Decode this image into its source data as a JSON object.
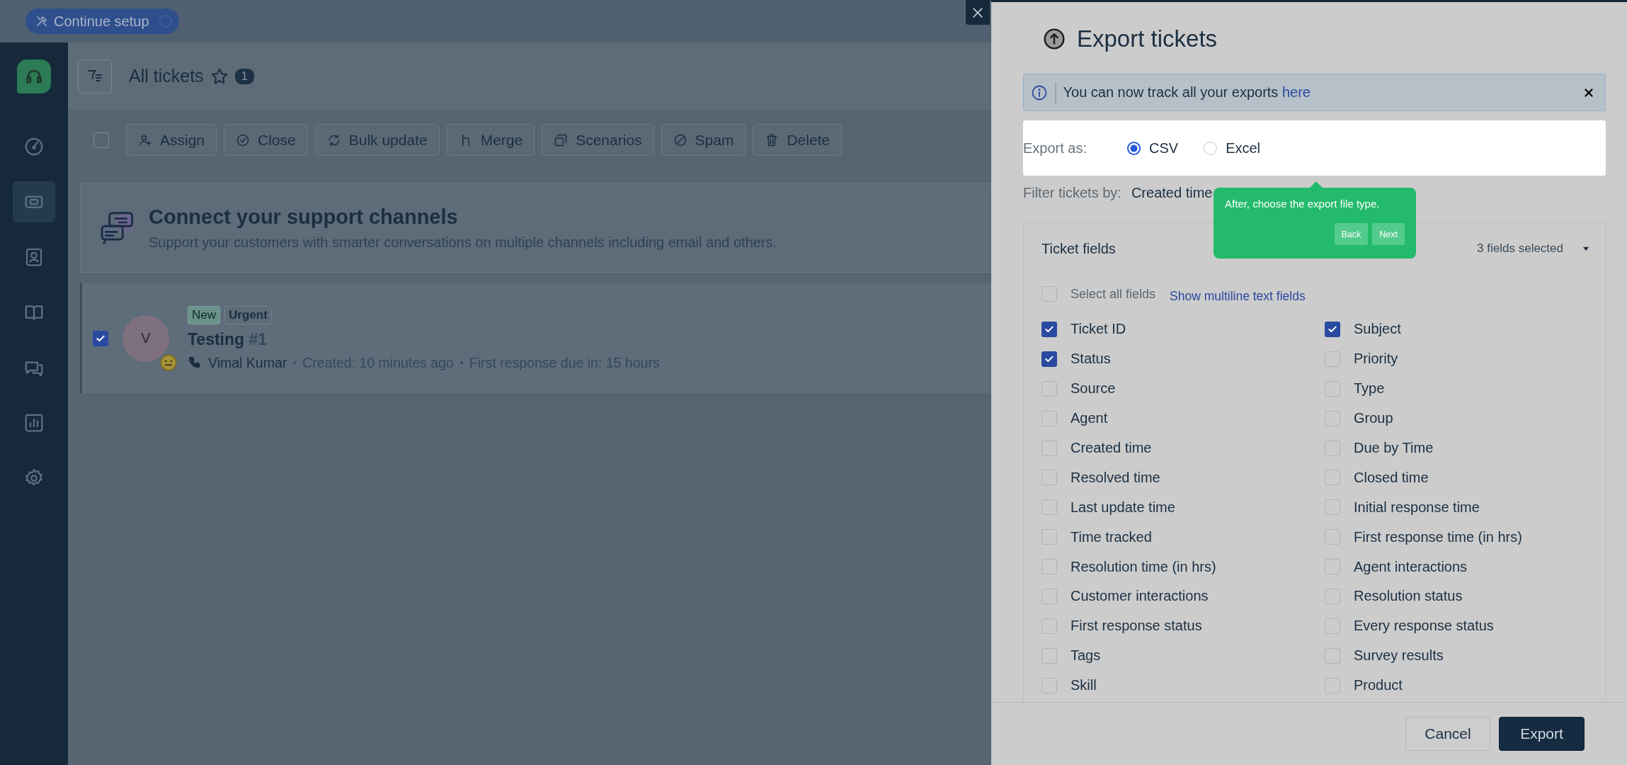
{
  "setup_button": {
    "label": "Continue setup"
  },
  "sidebar": {
    "items": [
      {
        "kind": "gauge",
        "selected": false
      },
      {
        "kind": "ticket",
        "selected": true
      },
      {
        "kind": "contact",
        "selected": false
      },
      {
        "kind": "book",
        "selected": false
      },
      {
        "kind": "chat",
        "selected": false
      },
      {
        "kind": "report",
        "selected": false
      },
      {
        "kind": "settings",
        "selected": false
      }
    ]
  },
  "header": {
    "title": "All tickets",
    "count": "1"
  },
  "toolbar": {
    "select_all": {
      "checked": false
    },
    "actions": [
      {
        "kind": "assign",
        "label": "Assign"
      },
      {
        "kind": "close",
        "label": "Close"
      },
      {
        "kind": "bulk",
        "label": "Bulk update"
      },
      {
        "kind": "merge",
        "label": "Merge"
      },
      {
        "kind": "scenarios",
        "label": "Scenarios"
      },
      {
        "kind": "spam",
        "label": "Spam"
      },
      {
        "kind": "delete",
        "label": "Delete"
      }
    ]
  },
  "banner": {
    "title": "Connect your support channels",
    "text": "Support your customers with smarter conversations on multiple channels including email and others."
  },
  "tickets": [
    {
      "checked": true,
      "avatar": "V",
      "tags": [
        {
          "kind": "status",
          "label": "New"
        },
        {
          "kind": "priority",
          "label": "Urgent"
        }
      ],
      "subject": "Testing",
      "number": "#1",
      "requester": "Vimal Kumar",
      "created": "Created: 10 minutes ago",
      "due": "First response due in: 15 hours"
    }
  ],
  "export_panel": {
    "title": "Export tickets",
    "info": {
      "text": "You can now track all your exports",
      "link": "here"
    },
    "export_as": {
      "label": "Export as:",
      "options": [
        {
          "label": "CSV",
          "selected": true
        },
        {
          "label": "Excel",
          "selected": false
        }
      ]
    },
    "filter": {
      "label": "Filter tickets by:",
      "value": "Created time"
    },
    "fields_card": {
      "title": "Ticket fields",
      "summary": "3 fields selected",
      "expanded": true,
      "select_all": {
        "label": "Select all fields",
        "checked": false
      },
      "multiline_link": "Show multiline text fields",
      "fields": [
        {
          "label": "Ticket ID",
          "checked": true
        },
        {
          "label": "Subject",
          "checked": true
        },
        {
          "label": "Status",
          "checked": true
        },
        {
          "label": "Priority",
          "checked": false
        },
        {
          "label": "Source",
          "checked": false
        },
        {
          "label": "Type",
          "checked": false
        },
        {
          "label": "Agent",
          "checked": false
        },
        {
          "label": "Group",
          "checked": false
        },
        {
          "label": "Created time",
          "checked": false
        },
        {
          "label": "Due by Time",
          "checked": false
        },
        {
          "label": "Resolved time",
          "checked": false
        },
        {
          "label": "Closed time",
          "checked": false
        },
        {
          "label": "Last update time",
          "checked": false
        },
        {
          "label": "Initial response time",
          "checked": false
        },
        {
          "label": "Time tracked",
          "checked": false
        },
        {
          "label": "First response time (in hrs)",
          "checked": false
        },
        {
          "label": "Resolution time (in hrs)",
          "checked": false
        },
        {
          "label": "Agent interactions",
          "checked": false
        },
        {
          "label": "Customer interactions",
          "checked": false
        },
        {
          "label": "Resolution status",
          "checked": false
        },
        {
          "label": "First response status",
          "checked": false
        },
        {
          "label": "Every response status",
          "checked": false
        },
        {
          "label": "Tags",
          "checked": false
        },
        {
          "label": "Survey results",
          "checked": false
        },
        {
          "label": "Skill",
          "checked": false
        },
        {
          "label": "Product",
          "checked": false
        }
      ]
    },
    "buttons": {
      "cancel": "Cancel",
      "export": "Export"
    }
  },
  "tooltip": {
    "text": "After, choose the export file type.",
    "buttons": [
      "Back",
      "Next"
    ]
  }
}
